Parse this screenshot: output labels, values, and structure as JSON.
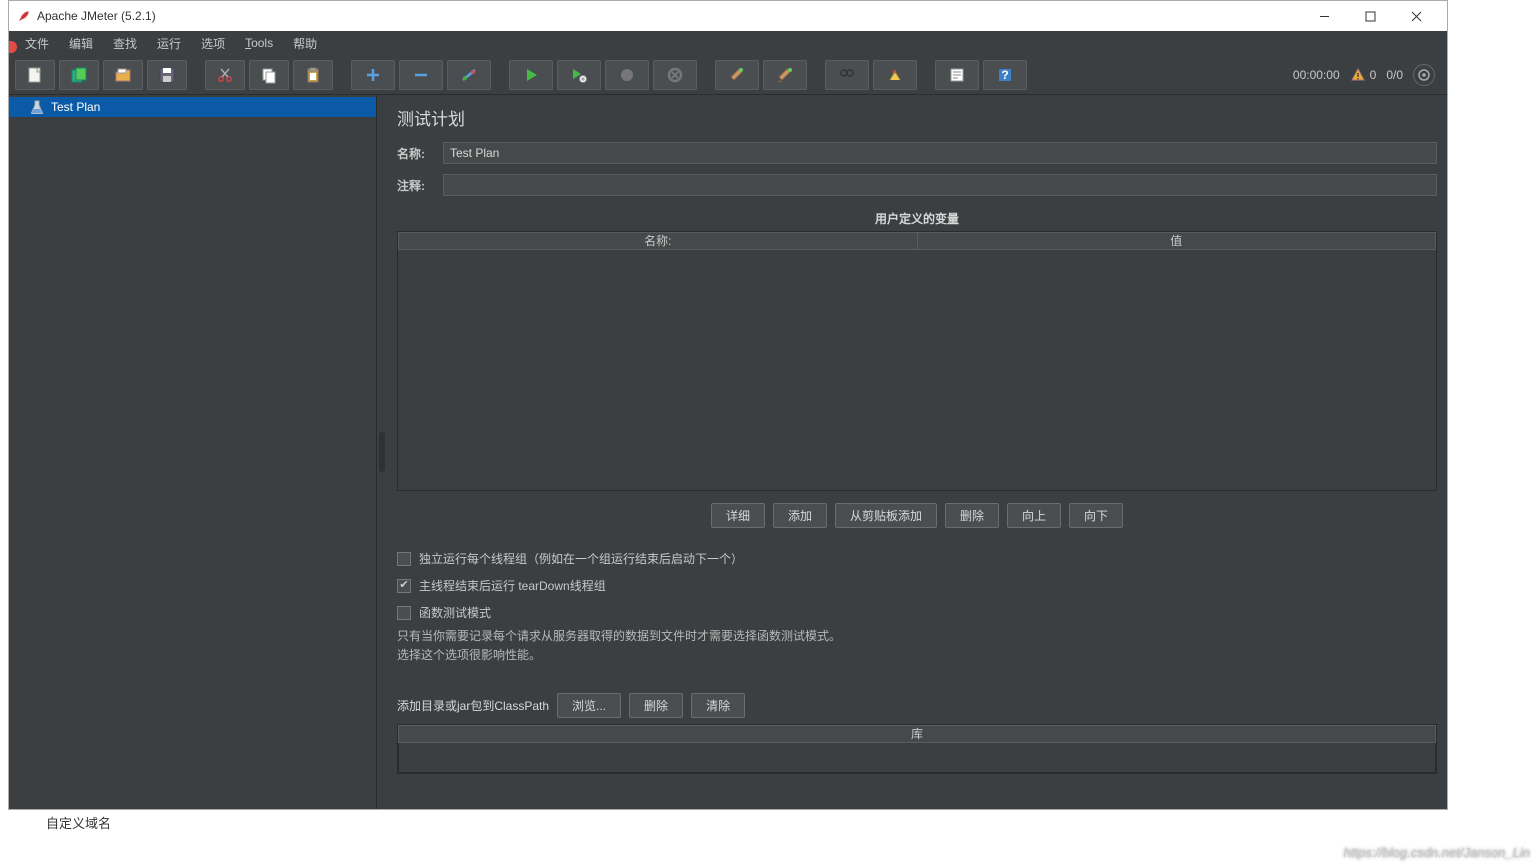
{
  "window": {
    "title": "Apache JMeter (5.2.1)"
  },
  "menu": {
    "file": "文件",
    "edit": "编辑",
    "search": "查找",
    "run": "运行",
    "options": "选项",
    "tools": "Tools",
    "help": "帮助"
  },
  "toolbar_icons": {
    "new": "new-file-icon",
    "templates": "templates-icon",
    "open": "open-icon",
    "save": "save-icon",
    "cut": "cut-icon",
    "copy": "copy-icon",
    "paste": "paste-icon",
    "plus": "plus-icon",
    "minus": "minus-icon",
    "toggle": "toggle-icon",
    "start": "start-icon",
    "start_no_timers": "start-remote-icon",
    "stop": "stop-icon",
    "shutdown": "shutdown-icon",
    "clear": "clear-icon",
    "clear_all": "clear-all-icon",
    "search_tool": "search-icon",
    "reset": "reset-search-icon",
    "func": "function-helper-icon",
    "help": "help-icon"
  },
  "status": {
    "time": "00:00:00",
    "warn_count": "0",
    "threads": "0/0"
  },
  "tree": {
    "root": "Test Plan"
  },
  "panel": {
    "title": "测试计划",
    "name_label": "名称:",
    "name_value": "Test Plan",
    "comment_label": "注释:",
    "comment_value": "",
    "vars_title": "用户定义的变量",
    "col_name": "名称:",
    "col_value": "值",
    "buttons": {
      "detail": "详细",
      "add": "添加",
      "from_clip": "从剪贴板添加",
      "delete": "删除",
      "up": "向上",
      "down": "向下"
    },
    "checks": {
      "serial": "独立运行每个线程组（例如在一个组运行结束后启动下一个）",
      "teardown": "主线程结束后运行 tearDown线程组",
      "func": "函数测试模式"
    },
    "hint1": "只有当你需要记录每个请求从服务器取得的数据到文件时才需要选择函数测试模式。",
    "hint2": "选择这个选项很影响性能。",
    "classpath_label": "添加目录或jar包到ClassPath",
    "browse": "浏览...",
    "cp_delete": "删除",
    "cp_clear": "清除",
    "lib_col": "库"
  },
  "watermark": "https://blog.csdn.net/Janson_Lin",
  "below_text": "自定义域名"
}
